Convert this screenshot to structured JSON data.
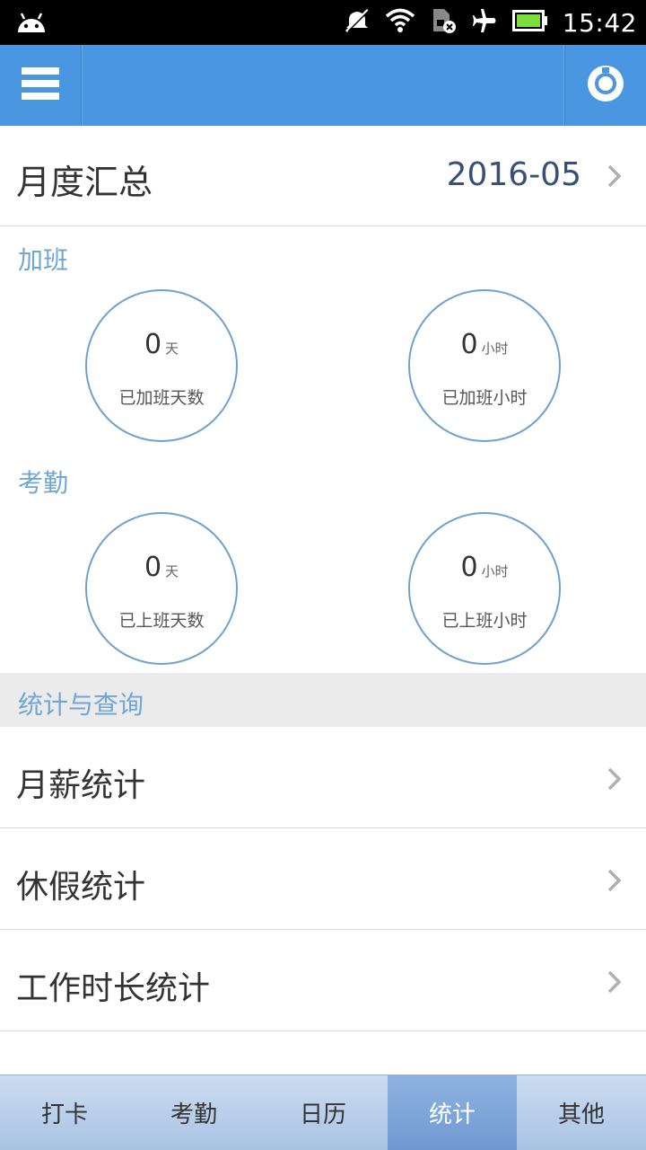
{
  "status_bar": {
    "time": "15:42",
    "icons": [
      "android-icon",
      "sound-off-icon",
      "wifi-icon",
      "sim-icon",
      "airplane-icon",
      "battery-icon"
    ]
  },
  "app_bar": {
    "menu_icon": "menu-icon",
    "settings_icon": "settings-icon",
    "color": "#4a96e0"
  },
  "summary": {
    "label": "月度汇总",
    "month": "2016-05"
  },
  "overtime": {
    "title": "加班",
    "days": {
      "value": "0",
      "unit": "天",
      "caption": "已加班天数"
    },
    "hours": {
      "value": "0",
      "unit": "小时",
      "caption": "已加班小时"
    }
  },
  "attendance": {
    "title": "考勤",
    "days": {
      "value": "0",
      "unit": "天",
      "caption": "已上班天数"
    },
    "hours": {
      "value": "0",
      "unit": "小时",
      "caption": "已上班小时"
    }
  },
  "stats": {
    "title": "统计与查询",
    "items": [
      {
        "label": "月薪统计"
      },
      {
        "label": "休假统计"
      },
      {
        "label": "工作时长统计"
      }
    ]
  },
  "bottom_nav": {
    "items": [
      {
        "label": "打卡"
      },
      {
        "label": "考勤"
      },
      {
        "label": "日历"
      },
      {
        "label": "统计"
      },
      {
        "label": "其他"
      }
    ],
    "active": "统计"
  }
}
